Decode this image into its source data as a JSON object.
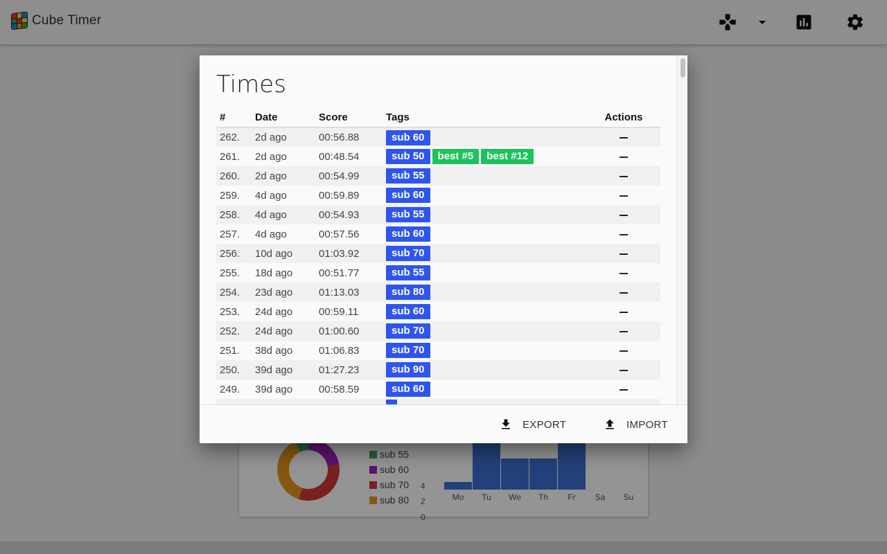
{
  "app": {
    "title": "Cube Timer"
  },
  "colors": {
    "sub_tag": "#2e55ee",
    "best_tag": "#1cc35a"
  },
  "icons": {
    "logo": "rubiks-cube-icon",
    "puzzle": "gamepad-icon",
    "dropdown": "caret-down-icon",
    "stats": "bar-chart-icon",
    "settings": "gear-icon",
    "export": "download-icon",
    "import": "upload-icon"
  },
  "dialog": {
    "title": "Times",
    "columns": {
      "num": "#",
      "date": "Date",
      "score": "Score",
      "tags": "Tags",
      "actions": "Actions"
    },
    "rows": [
      {
        "num": "262.",
        "date": "2d ago",
        "score": "00:56.88",
        "tags": [
          "sub 60"
        ],
        "best": []
      },
      {
        "num": "261.",
        "date": "2d ago",
        "score": "00:48.54",
        "tags": [
          "sub 50"
        ],
        "best": [
          "best #5",
          "best #12"
        ]
      },
      {
        "num": "260.",
        "date": "2d ago",
        "score": "00:54.99",
        "tags": [
          "sub 55"
        ],
        "best": []
      },
      {
        "num": "259.",
        "date": "4d ago",
        "score": "00:59.89",
        "tags": [
          "sub 60"
        ],
        "best": []
      },
      {
        "num": "258.",
        "date": "4d ago",
        "score": "00:54.93",
        "tags": [
          "sub 55"
        ],
        "best": []
      },
      {
        "num": "257.",
        "date": "4d ago",
        "score": "00:57.56",
        "tags": [
          "sub 60"
        ],
        "best": []
      },
      {
        "num": "256.",
        "date": "10d ago",
        "score": "01:03.92",
        "tags": [
          "sub 70"
        ],
        "best": []
      },
      {
        "num": "255.",
        "date": "18d ago",
        "score": "00:51.77",
        "tags": [
          "sub 55"
        ],
        "best": []
      },
      {
        "num": "254.",
        "date": "23d ago",
        "score": "01:13.03",
        "tags": [
          "sub 80"
        ],
        "best": []
      },
      {
        "num": "253.",
        "date": "24d ago",
        "score": "00:59.11",
        "tags": [
          "sub 60"
        ],
        "best": []
      },
      {
        "num": "252.",
        "date": "24d ago",
        "score": "01:00.60",
        "tags": [
          "sub 70"
        ],
        "best": []
      },
      {
        "num": "251.",
        "date": "38d ago",
        "score": "01:06.83",
        "tags": [
          "sub 70"
        ],
        "best": []
      },
      {
        "num": "250.",
        "date": "39d ago",
        "score": "01:27.23",
        "tags": [
          "sub 90"
        ],
        "best": []
      },
      {
        "num": "249.",
        "date": "39d ago",
        "score": "00:58.59",
        "tags": [
          "sub 60"
        ],
        "best": []
      },
      {
        "num": "",
        "date": "",
        "score": "",
        "tags": [
          ""
        ],
        "best": []
      }
    ],
    "footer": {
      "export_label": "EXPORT",
      "import_label": "IMPORT"
    }
  },
  "background_stats": {
    "legend": [
      {
        "label": "sub 55",
        "color": "#3aa35a"
      },
      {
        "label": "sub 60",
        "color": "#a020c0"
      },
      {
        "label": "sub 70",
        "color": "#d03a3a"
      },
      {
        "label": "sub 80",
        "color": "#e8961c"
      }
    ],
    "chart_data": {
      "type": "bar",
      "categories": [
        "Mo",
        "Tu",
        "We",
        "Th",
        "Fr",
        "Sa",
        "Su"
      ],
      "values": [
        1,
        6,
        4,
        4,
        6,
        0,
        0
      ],
      "yticks": [
        "4",
        "2",
        "0"
      ],
      "ylim": [
        0,
        6
      ],
      "bar_color": "#3b6fd0"
    }
  }
}
